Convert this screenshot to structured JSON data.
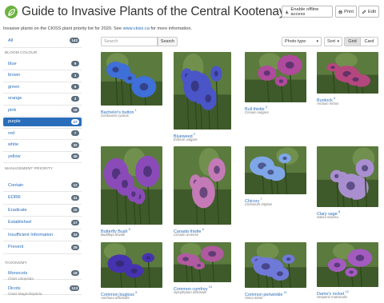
{
  "header": {
    "title": "Guide to Invasive Plants of the Central Kootenays",
    "buttons": [
      {
        "label": "Enable offline access",
        "icon": "download-icon"
      },
      {
        "label": "Print",
        "icon": "print-icon"
      },
      {
        "label": "Edit",
        "icon": "edit-icon"
      }
    ]
  },
  "intro": {
    "text": "Invasive plants on the CKISS plant priority list for 2020. See ",
    "link": "www.ckiss.ca",
    "suffix": " for more information."
  },
  "search": {
    "placeholder": "Search",
    "button": "Search"
  },
  "toolbar": {
    "phototype": "Photo type",
    "sort": "Sort",
    "grid": "Grid",
    "card": "Card",
    "active_view": "Grid"
  },
  "sidebar": {
    "all": {
      "label": "All",
      "count": "142"
    },
    "bloom_colour": {
      "heading": "BLOOM COLOUR",
      "items": [
        {
          "label": "blue",
          "count": "9"
        },
        {
          "label": "brown",
          "count": "3"
        },
        {
          "label": "green",
          "count": "6"
        },
        {
          "label": "orange",
          "count": "3"
        },
        {
          "label": "pink",
          "count": "19"
        },
        {
          "label": "purple",
          "count": "17",
          "active": true
        },
        {
          "label": "red",
          "count": "7"
        },
        {
          "label": "white",
          "count": "32"
        },
        {
          "label": "yellow",
          "count": "45"
        }
      ]
    },
    "management": {
      "heading": "MANAGEMENT PRIORITY",
      "items": [
        {
          "label": "Contain",
          "count": "12"
        },
        {
          "label": "EDRR",
          "count": "41"
        },
        {
          "label": "Eradicate",
          "count": "10"
        },
        {
          "label": "Established",
          "count": "17"
        },
        {
          "label": "Insufficient Information",
          "count": "33"
        },
        {
          "label": "Prevent",
          "count": "29"
        }
      ]
    },
    "taxonomy": {
      "heading": "TAXONOMY",
      "items": [
        {
          "label": "Monocots",
          "sub": "Class Liliopsida",
          "count": "19"
        },
        {
          "label": "Dicots",
          "sub": "Class Magnoliopsida",
          "count": "123"
        }
      ]
    }
  },
  "plants": [
    {
      "name": "Bachelor's button",
      "num": "1",
      "sci": "Centaurea cyanus",
      "color": "#3f6fd8"
    },
    {
      "name": "Blueweed",
      "num": "2",
      "sci": "Echium vulgare",
      "color": "#4a55c8"
    },
    {
      "name": "Bull thistle",
      "num": "3",
      "sci": "Cirsium vulgare",
      "color": "#b04a9c"
    },
    {
      "name": "Burdock",
      "num": "4",
      "sci": "Arctium minus",
      "color": "#b5477f"
    },
    {
      "name": "Butterfly Bush",
      "num": "5",
      "sci": "Buddleja davidii",
      "color": "#8a4bb8"
    },
    {
      "name": "Canada thistle",
      "num": "6",
      "sci": "Cirsium arvense",
      "color": "#c47ab6"
    },
    {
      "name": "Chicory",
      "num": "7",
      "sci": "Cichorium intybus",
      "color": "#7fa7e8"
    },
    {
      "name": "Clary sage",
      "num": "8",
      "sci": "Salvia sclarea",
      "color": "#a98fcf"
    },
    {
      "name": "Common bugloss",
      "num": "9",
      "sci": "Anchusa officinalis",
      "color": "#4633b0"
    },
    {
      "name": "Common comfrey",
      "num": "10",
      "sci": "Symphytum officinale",
      "color": "#b05aa0"
    },
    {
      "name": "Common periwinkle",
      "num": "11",
      "sci": "Vinca minor",
      "color": "#6f79d8"
    },
    {
      "name": "Dame's rocket",
      "num": "12",
      "sci": "Hesperis matronalis",
      "color": "#a35bbf"
    }
  ]
}
